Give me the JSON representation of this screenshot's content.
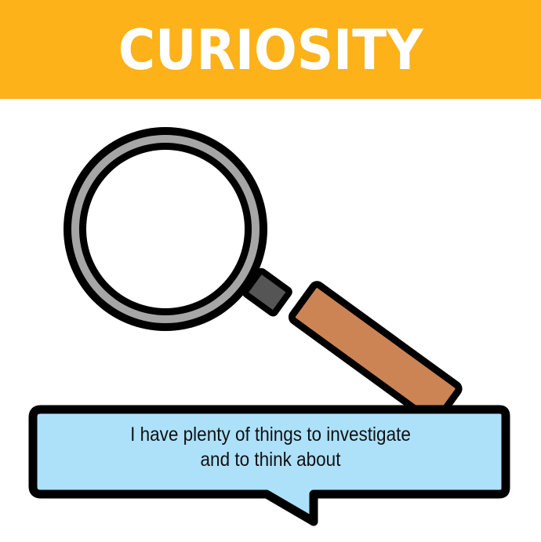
{
  "banner": {
    "title": "CURIOSITY"
  },
  "bubble": {
    "line1": "I have plenty of things to investigate",
    "line2": "and to think about"
  },
  "icons": {
    "illustration": "magnifying-glass-icon",
    "speech": "speech-bubble-icon"
  },
  "colors": {
    "banner": "#FDB219",
    "bubble_fill": "#ADE1FA",
    "handle": "#CD8455",
    "rim": "#A6A6A6",
    "outline": "#000000"
  }
}
